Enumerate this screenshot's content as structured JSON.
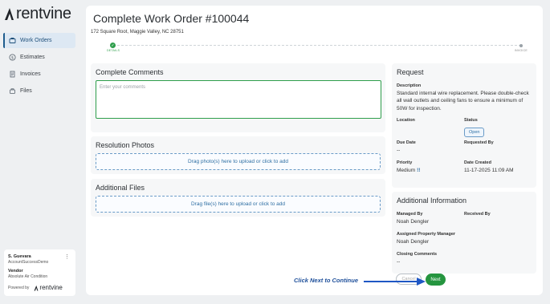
{
  "brand": {
    "name": "rentvine"
  },
  "sidebar": {
    "items": [
      {
        "label": "Work Orders",
        "icon": "work-orders-icon",
        "active": true
      },
      {
        "label": "Estimates",
        "icon": "dollar-icon",
        "active": false
      },
      {
        "label": "Invoices",
        "icon": "invoice-icon",
        "active": false
      },
      {
        "label": "Files",
        "icon": "file-icon",
        "active": false
      }
    ]
  },
  "user": {
    "name": "S. Guevara",
    "account": "AccountSuccessDemo",
    "vendor_label": "Vendor",
    "vendor_name": "Absolute Air Condition",
    "powered_by": "Powered by",
    "powered_brand": "rentvine"
  },
  "page": {
    "title": "Complete Work Order #100044",
    "address": "172 Square Root, Maggie Valley, NC 28751"
  },
  "stepper": {
    "steps": [
      {
        "label": "DETAILS",
        "state": "complete"
      },
      {
        "label": "INVOICE",
        "state": "pending"
      }
    ]
  },
  "comments": {
    "title": "Complete Comments",
    "placeholder": "Enter your comments",
    "value": ""
  },
  "photos": {
    "title": "Resolution Photos",
    "dropzone": "Drag photo(s) here to upload or click to add"
  },
  "files": {
    "title": "Additional Files",
    "dropzone": "Drag file(s) here to upload or click to add"
  },
  "request": {
    "title": "Request",
    "description_label": "Description",
    "description": "Standard internal wire replacement. Please double-check all wall outlets and ceiling fans to ensure a minimum of 50W for inspection.",
    "location_label": "Location",
    "location": "",
    "status_label": "Status",
    "status": "Open",
    "due_date_label": "Due Date",
    "due_date": "--",
    "requested_by_label": "Requested By",
    "requested_by": "",
    "priority_label": "Priority",
    "priority": "Medium",
    "priority_mark": "!!",
    "date_created_label": "Date Created",
    "date_created": "11-17-2025 11:09 AM"
  },
  "additional_info": {
    "title": "Additional Information",
    "managed_by_label": "Managed By",
    "managed_by": "Noah Dengler",
    "received_by_label": "Received By",
    "received_by": "",
    "assigned_pm_label": "Assigned Property Manager",
    "assigned_pm": "Noah Dengler",
    "closing_comments_label": "Closing Comments",
    "closing_comments": "--"
  },
  "footer": {
    "hint": "Click Next to Continue",
    "cancel_label": "Cancel",
    "next_label": "Next"
  },
  "colors": {
    "accent_green": "#25953f",
    "accent_blue": "#2f6fa3",
    "hint_blue": "#1e4f9a"
  }
}
